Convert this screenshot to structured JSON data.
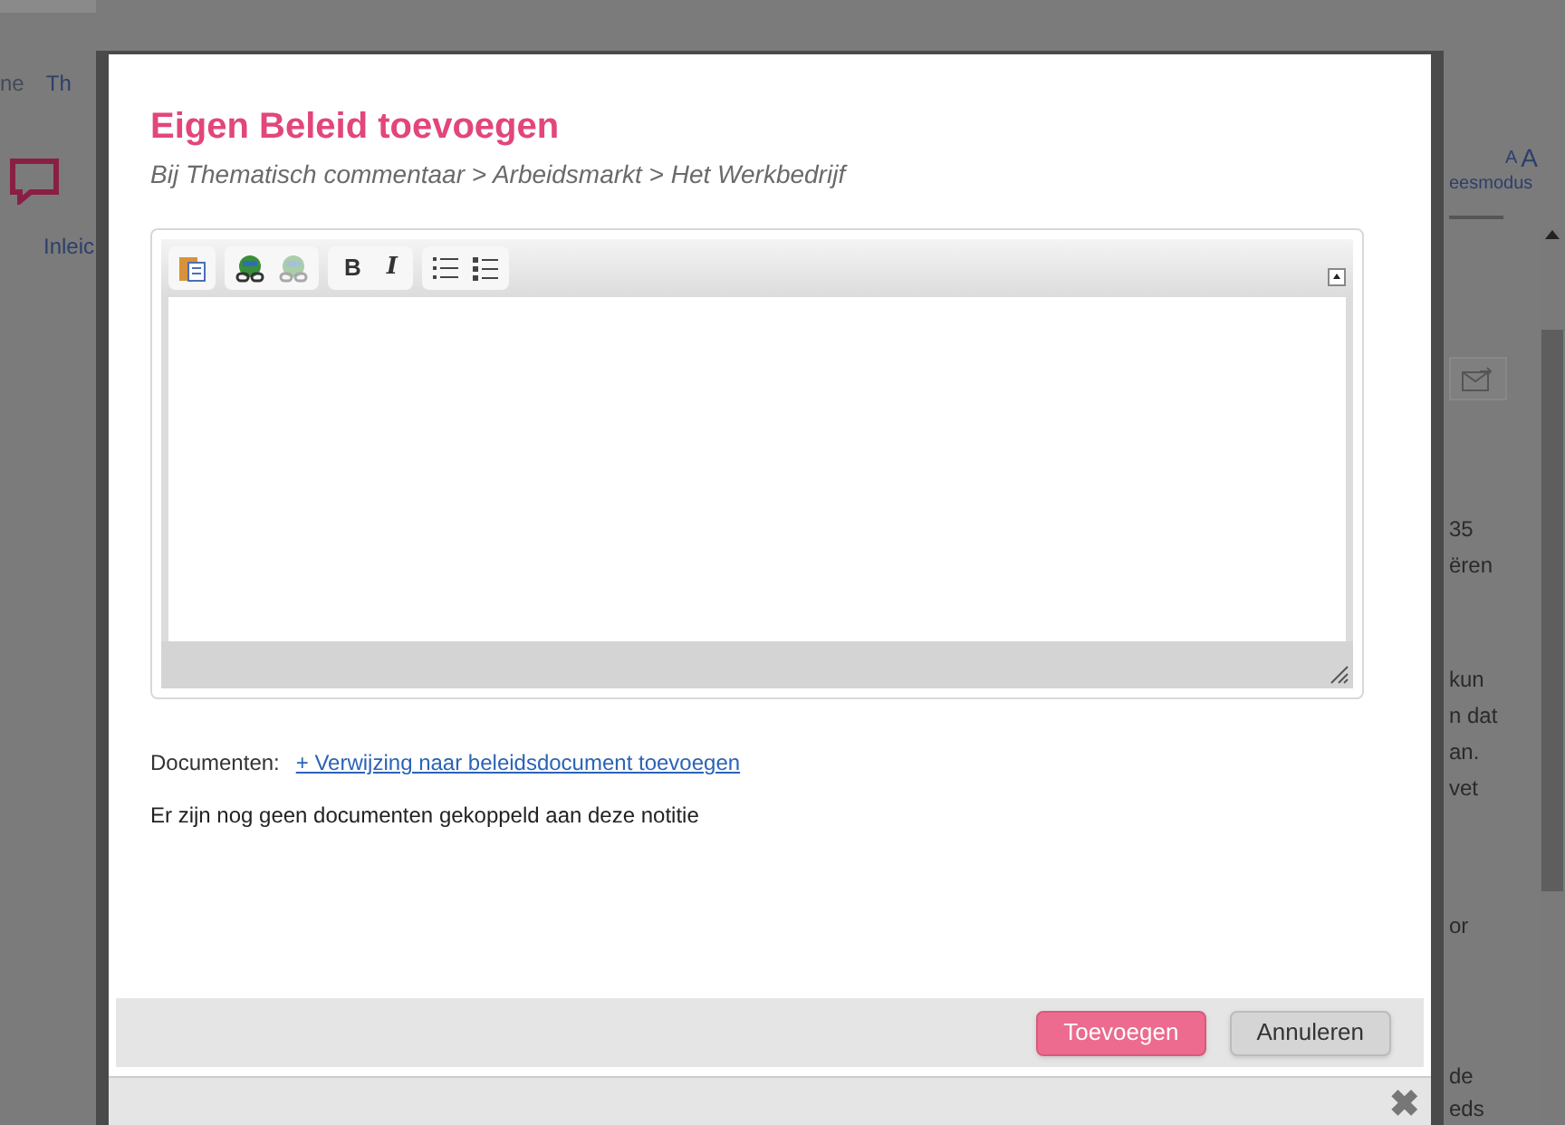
{
  "background_page": {
    "breadcrumb": [
      "ne",
      "Th"
    ],
    "left_tab": "Inleic",
    "font_size_small": "A",
    "font_size_large": "A",
    "reading_mode": "eesmodus",
    "text_fragments": [
      "35",
      "ëren",
      "kun",
      "n dat",
      "an.",
      "vet",
      "or",
      "de",
      "eds"
    ]
  },
  "dialog": {
    "title": "Eigen Beleid toevoegen",
    "subtitle": "Bij Thematisch commentaar > Arbeidsmarkt > Het Werkbedrijf",
    "editor": {
      "toolbar_groups": [
        [
          {
            "kind": "paste",
            "disabled": false
          }
        ],
        [
          {
            "kind": "link",
            "disabled": false
          },
          {
            "kind": "unlink",
            "disabled": true
          }
        ],
        [
          {
            "kind": "bold",
            "label": "B",
            "disabled": false
          },
          {
            "kind": "italic",
            "label": "I",
            "disabled": false
          }
        ],
        [
          {
            "kind": "ordered-list",
            "disabled": false
          },
          {
            "kind": "bullet-list",
            "disabled": false
          }
        ]
      ]
    },
    "documents_label": "Documenten:",
    "add_document_link": "+ Verwijzing naar beleidsdocument toevoegen",
    "no_documents_text": "Er zijn nog geen documenten gekoppeld aan deze notitie",
    "buttons": [
      {
        "label": "Toevoegen",
        "kind": "primary"
      },
      {
        "label": "Annuleren",
        "kind": "secondary"
      }
    ],
    "close_icon": "✖"
  }
}
